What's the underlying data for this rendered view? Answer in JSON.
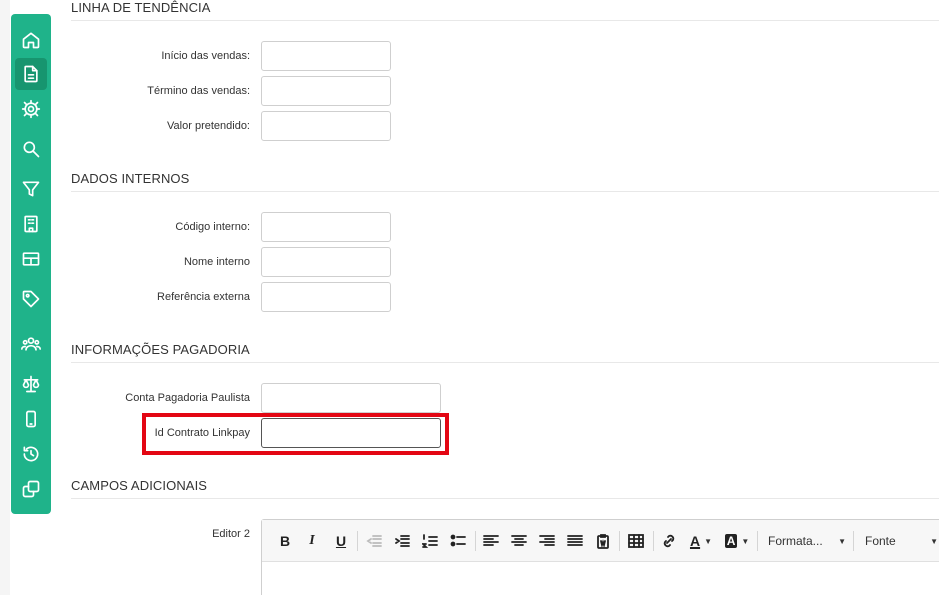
{
  "sidebar": {
    "items": [
      {
        "icon": "home-icon"
      },
      {
        "icon": "document-icon",
        "active": true
      },
      {
        "icon": "gear-icon"
      },
      {
        "icon": "search-icon"
      },
      {
        "icon": "filter-icon"
      },
      {
        "icon": "building-icon"
      },
      {
        "icon": "table-icon"
      },
      {
        "icon": "tag-icon"
      },
      {
        "icon": "users-icon"
      },
      {
        "icon": "scale-icon"
      },
      {
        "icon": "mobile-icon"
      },
      {
        "icon": "history-icon"
      },
      {
        "icon": "copy-icon"
      }
    ],
    "accent_color": "#1fb38a"
  },
  "sections": {
    "trend": {
      "title": "LINHA DE TENDÊNCIA",
      "fields": [
        {
          "label": "Início das vendas:",
          "value": ""
        },
        {
          "label": "Término das vendas:",
          "value": ""
        },
        {
          "label": "Valor pretendido:",
          "value": ""
        }
      ]
    },
    "internal": {
      "title": "DADOS INTERNOS",
      "fields": [
        {
          "label": "Código interno:",
          "value": ""
        },
        {
          "label": "Nome interno",
          "value": ""
        },
        {
          "label": "Referência externa",
          "value": ""
        }
      ]
    },
    "payment": {
      "title": "INFORMAÇÕES PAGADORIA",
      "fields": [
        {
          "label": "Conta Pagadoria Paulista",
          "value": ""
        },
        {
          "label": "Id Contrato Linkpay",
          "value": ""
        }
      ],
      "highlight_color": "#e30613"
    },
    "additional": {
      "title": "CAMPOS ADICIONAIS",
      "editor_label": "Editor 2",
      "toolbar": {
        "bold": "B",
        "italic": "I",
        "underline": "U",
        "format_label": "Formata...",
        "font_label": "Fonte"
      }
    }
  }
}
